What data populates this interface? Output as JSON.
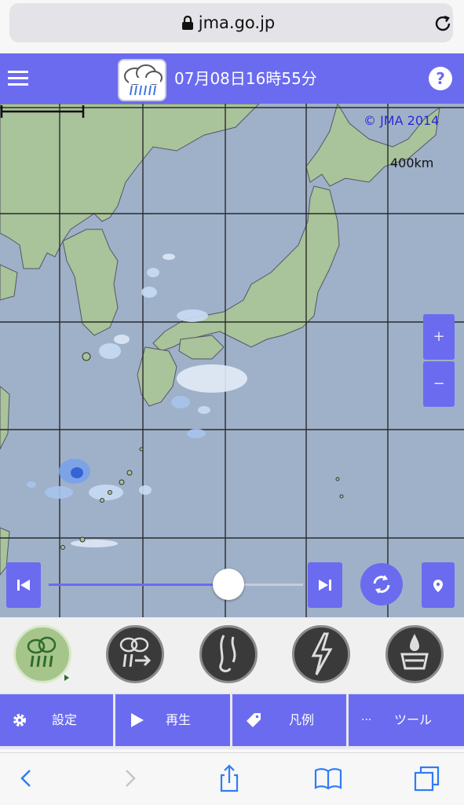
{
  "browser": {
    "url": "jma.go.jp"
  },
  "header": {
    "datetime": "07月08日16時55分"
  },
  "map": {
    "copyright": "© JMA 2014",
    "scale_label": "400km"
  },
  "zoom": {
    "in_label": "+",
    "out_label": "−"
  },
  "timeline": {
    "position_fraction": 0.79
  },
  "layers": [
    {
      "name": "rain-radar-icon",
      "active": true
    },
    {
      "name": "rain-forecast-icon",
      "active": false
    },
    {
      "name": "tornado-icon",
      "active": false
    },
    {
      "name": "lightning-icon",
      "active": false
    },
    {
      "name": "flood-drop-icon",
      "active": false
    }
  ],
  "menu": {
    "settings": "設定",
    "play": "再生",
    "legend": "凡例",
    "tools": "ツール",
    "tools_prefix": "···"
  },
  "colors": {
    "accent": "#6b6bf0",
    "land": "#a9c39a",
    "sea": "#9fb1c9"
  }
}
